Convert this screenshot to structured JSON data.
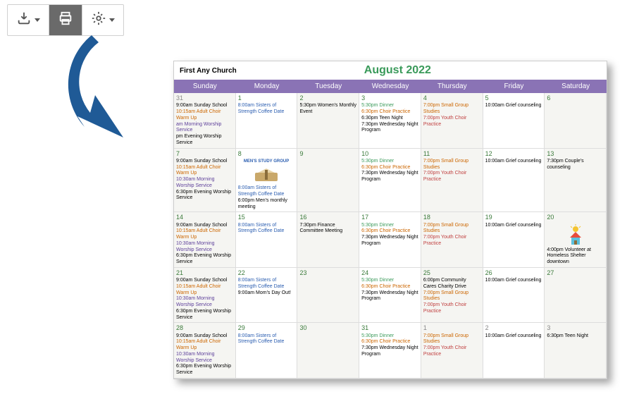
{
  "toolbar": {
    "download": "Download",
    "print": "Print",
    "settings": "Settings"
  },
  "calendar": {
    "churchName": "First Any Church",
    "monthTitle": "August 2022",
    "dow": [
      "Sunday",
      "Monday",
      "Tuesday",
      "Wednesday",
      "Thursday",
      "Friday",
      "Saturday"
    ],
    "weeks": [
      {
        "days": [
          {
            "num": "31",
            "outside": true,
            "bg": "alt",
            "events": [
              {
                "t": "9:00am Sunday School",
                "c": "black"
              },
              {
                "t": "10:15am Adult Choir Warm Up",
                "c": "orange"
              },
              {
                "t": "am Morning Worship Service",
                "c": "purple"
              },
              {
                "t": "pm Evening Worship Service",
                "c": "black"
              }
            ]
          },
          {
            "num": "1",
            "events": [
              {
                "t": "8:00am Sisters of Strength Coffee Date",
                "c": "blue"
              }
            ]
          },
          {
            "num": "2",
            "bg": "alt",
            "events": [
              {
                "t": "5:30pm Women's Monthly Event",
                "c": "black"
              }
            ]
          },
          {
            "num": "3",
            "events": [
              {
                "t": "5:30pm Dinner",
                "c": "green"
              },
              {
                "t": "6:30pm Choir Practice",
                "c": "orange"
              },
              {
                "t": "6:30pm Teen Night",
                "c": "black"
              },
              {
                "t": "7:30pm Wednesday Night Program",
                "c": "black"
              }
            ]
          },
          {
            "num": "4",
            "bg": "alt",
            "events": [
              {
                "t": "7:00pm Small Group Studies",
                "c": "orange"
              },
              {
                "t": "7:00pm Youth Choir Practice",
                "c": "red"
              }
            ]
          },
          {
            "num": "5",
            "events": [
              {
                "t": "10:00am Grief counseling",
                "c": "black"
              }
            ]
          },
          {
            "num": "6",
            "bg": "alt",
            "events": []
          }
        ]
      },
      {
        "days": [
          {
            "num": "7",
            "bg": "alt",
            "events": [
              {
                "t": "9:00am Sunday School",
                "c": "black"
              },
              {
                "t": "10:15am Adult Choir Warm Up",
                "c": "orange"
              },
              {
                "t": "10:30am Morning Worship Service",
                "c": "purple"
              },
              {
                "t": "6:30pm Evening Worship Service",
                "c": "black"
              }
            ]
          },
          {
            "num": "8",
            "mens": true,
            "events": [
              {
                "t": "8:00am Sisters of Strength Coffee Date",
                "c": "blue"
              },
              {
                "t": "6:00pm Men's monthly meeting",
                "c": "black"
              }
            ]
          },
          {
            "num": "9",
            "bg": "alt",
            "events": []
          },
          {
            "num": "10",
            "events": [
              {
                "t": "5:30pm Dinner",
                "c": "green"
              },
              {
                "t": "6:30pm Choir Practice",
                "c": "orange"
              },
              {
                "t": "7:30pm Wednesday Night Program",
                "c": "black"
              }
            ]
          },
          {
            "num": "11",
            "bg": "alt",
            "events": [
              {
                "t": "7:00pm Small Group Studies",
                "c": "orange"
              },
              {
                "t": "7:00pm Youth Choir Practice",
                "c": "red"
              }
            ]
          },
          {
            "num": "12",
            "events": [
              {
                "t": "10:00am Grief counseling",
                "c": "black"
              }
            ]
          },
          {
            "num": "13",
            "bg": "alt",
            "events": [
              {
                "t": "7:30pm Couple's counseling",
                "c": "black"
              }
            ]
          }
        ]
      },
      {
        "days": [
          {
            "num": "14",
            "bg": "alt",
            "events": [
              {
                "t": "9:00am Sunday School",
                "c": "black"
              },
              {
                "t": "10:15am Adult Choir Warm Up",
                "c": "orange"
              },
              {
                "t": "10:30am Morning Worship Service",
                "c": "purple"
              },
              {
                "t": "6:30pm Evening Worship Service",
                "c": "black"
              }
            ]
          },
          {
            "num": "15",
            "events": [
              {
                "t": "8:00am Sisters of Strength Coffee Date",
                "c": "blue"
              }
            ]
          },
          {
            "num": "16",
            "bg": "alt",
            "events": [
              {
                "t": "7:30pm Finance Committee Meeting",
                "c": "black"
              }
            ]
          },
          {
            "num": "17",
            "events": [
              {
                "t": "5:30pm Dinner",
                "c": "green"
              },
              {
                "t": "6:30pm Choir Practice",
                "c": "orange"
              },
              {
                "t": "7:30pm Wednesday Night Program",
                "c": "black"
              }
            ]
          },
          {
            "num": "18",
            "bg": "alt",
            "events": [
              {
                "t": "7:00pm Small Group Studies",
                "c": "orange"
              },
              {
                "t": "7:00pm Youth Choir Practice",
                "c": "red"
              }
            ]
          },
          {
            "num": "19",
            "events": [
              {
                "t": "10:00am Grief counseling",
                "c": "black"
              }
            ]
          },
          {
            "num": "20",
            "bg": "alt",
            "house": true,
            "events": [
              {
                "t": "4:00pm Volunteer at Homeless Shelter downtown",
                "c": "black"
              }
            ]
          }
        ]
      },
      {
        "days": [
          {
            "num": "21",
            "bg": "alt",
            "events": [
              {
                "t": "9:00am Sunday School",
                "c": "black"
              },
              {
                "t": "10:15am Adult Choir Warm Up",
                "c": "orange"
              },
              {
                "t": "10:30am Morning Worship Service",
                "c": "purple"
              },
              {
                "t": "6:30pm Evening Worship Service",
                "c": "black"
              }
            ]
          },
          {
            "num": "22",
            "events": [
              {
                "t": "8:00am Sisters of Strength Coffee Date",
                "c": "blue"
              },
              {
                "t": "9:00am Mom's Day Out!",
                "c": "black"
              }
            ]
          },
          {
            "num": "23",
            "bg": "alt",
            "events": []
          },
          {
            "num": "24",
            "events": [
              {
                "t": "5:30pm Dinner",
                "c": "green"
              },
              {
                "t": "6:30pm Choir Practice",
                "c": "orange"
              },
              {
                "t": "7:30pm Wednesday Night Program",
                "c": "black"
              }
            ]
          },
          {
            "num": "25",
            "bg": "alt",
            "events": [
              {
                "t": "6:00pm Community Cares Charity Drive",
                "c": "black"
              },
              {
                "t": "7:00pm Small Group Studies",
                "c": "orange"
              },
              {
                "t": "7:00pm Youth Choir Practice",
                "c": "red"
              }
            ]
          },
          {
            "num": "26",
            "events": [
              {
                "t": "10:00am Grief counseling",
                "c": "black"
              }
            ]
          },
          {
            "num": "27",
            "bg": "alt",
            "events": []
          }
        ]
      },
      {
        "days": [
          {
            "num": "28",
            "bg": "alt",
            "events": [
              {
                "t": "9:00am Sunday School",
                "c": "black"
              },
              {
                "t": "10:15am Adult Choir Warm Up",
                "c": "orange"
              },
              {
                "t": "10:30am Morning Worship Service",
                "c": "purple"
              },
              {
                "t": "6:30pm Evening Worship Service",
                "c": "black"
              }
            ]
          },
          {
            "num": "29",
            "events": [
              {
                "t": "8:00am Sisters of Strength Coffee Date",
                "c": "blue"
              }
            ]
          },
          {
            "num": "30",
            "bg": "alt",
            "events": []
          },
          {
            "num": "31",
            "events": [
              {
                "t": "5:30pm Dinner",
                "c": "green"
              },
              {
                "t": "6:30pm Choir Practice",
                "c": "orange"
              },
              {
                "t": "7:30pm Wednesday Night Program",
                "c": "black"
              }
            ]
          },
          {
            "num": "1",
            "outside": true,
            "bg": "alt",
            "events": [
              {
                "t": "7:00pm Small Group Studies",
                "c": "orange"
              },
              {
                "t": "7:00pm Youth Choir Practice",
                "c": "red"
              }
            ]
          },
          {
            "num": "2",
            "outside": true,
            "events": [
              {
                "t": "10:00am Grief counseling",
                "c": "black"
              }
            ]
          },
          {
            "num": "3",
            "outside": true,
            "bg": "alt",
            "events": [
              {
                "t": "6:30pm Teen Night",
                "c": "black"
              }
            ]
          }
        ]
      }
    ],
    "mensStudyLabel": "MEN'S STUDY GROUP"
  }
}
